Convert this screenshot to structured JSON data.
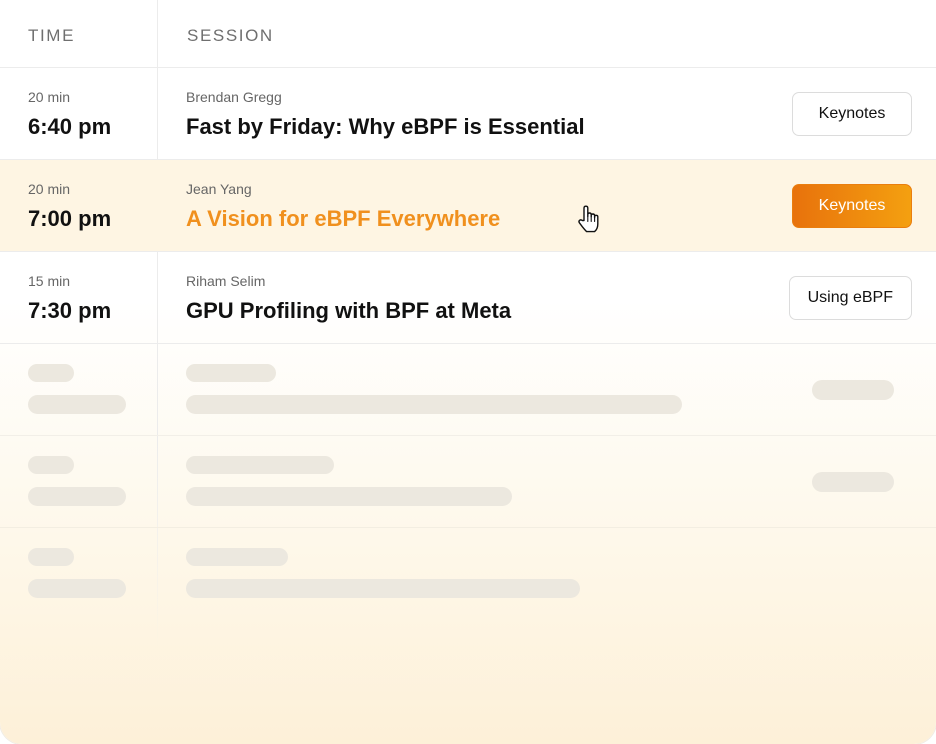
{
  "table": {
    "headers": {
      "time": "TIME",
      "session": "SESSION"
    }
  },
  "sessions": [
    {
      "duration": "20 min",
      "time": "6:40 pm",
      "speaker": "Brendan Gregg",
      "title": "Fast by Friday: Why eBPF is Essential",
      "tag": "Keynotes",
      "highlighted": false
    },
    {
      "duration": "20 min",
      "time": "7:00 pm",
      "speaker": "Jean Yang",
      "title": "A Vision for eBPF Everywhere",
      "tag": "Keynotes",
      "highlighted": true
    },
    {
      "duration": "15 min",
      "time": "7:30 pm",
      "speaker": "Riham Selim",
      "title": "GPU Profiling with BPF at Meta",
      "tag": "Using eBPF",
      "highlighted": false
    }
  ],
  "loading_placeholders": 3,
  "colors": {
    "accent": "#f0901e",
    "accent_button_start": "#e8720c",
    "accent_button_end": "#f4a010",
    "highlight_row": "#fef5e3",
    "skeleton": "#ece8df"
  },
  "icons": {
    "cursor": "pointer-hand-icon"
  }
}
